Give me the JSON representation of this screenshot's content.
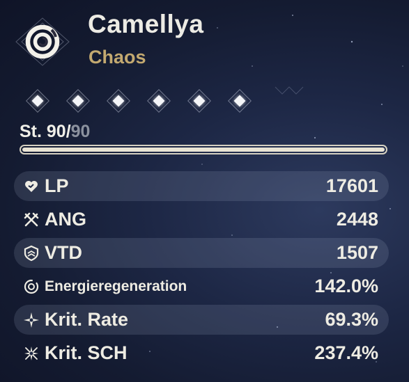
{
  "character": {
    "name": "Camellya",
    "element": "Chaos",
    "element_color": "#c3a970",
    "emblem_icon": "spiral-emblem-icon"
  },
  "resonance_chain": {
    "unlocked": 6,
    "total": 6
  },
  "level": {
    "prefix": "St. 90/",
    "max": "90",
    "progress": 1.0
  },
  "stats": [
    {
      "icon": "heart-icon",
      "label": "LP",
      "value": "17601"
    },
    {
      "icon": "crossed-swords-icon",
      "label": "ANG",
      "value": "2448"
    },
    {
      "icon": "shield-icon",
      "label": "VTD",
      "value": "1507"
    },
    {
      "icon": "energy-regen-icon",
      "label": "Energieregeneration",
      "value": "142.0%"
    },
    {
      "icon": "crit-rate-icon",
      "label": "Krit. Rate",
      "value": "69.3%"
    },
    {
      "icon": "crit-damage-icon",
      "label": "Krit. SCH",
      "value": "237.4%"
    }
  ]
}
